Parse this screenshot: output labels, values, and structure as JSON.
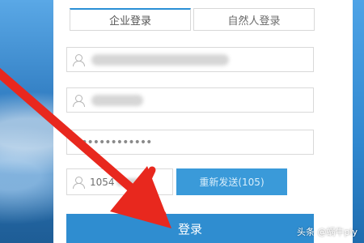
{
  "tabs": [
    {
      "label": "企业登录",
      "active": true
    },
    {
      "label": "自然人登录",
      "active": false
    }
  ],
  "fields": {
    "account_icon": "user-icon",
    "name_icon": "user-icon",
    "password_value": "•••••••••••••"
  },
  "verification": {
    "code_prefix": "1054",
    "resend_label": "重新发送(105)"
  },
  "login_button": {
    "label": "登录"
  },
  "watermark": "头条 @蜗牛ply",
  "colors": {
    "accent": "#2f8dd0",
    "arrow": "#e8281e",
    "tab_active_border": "#2a8fd6"
  }
}
